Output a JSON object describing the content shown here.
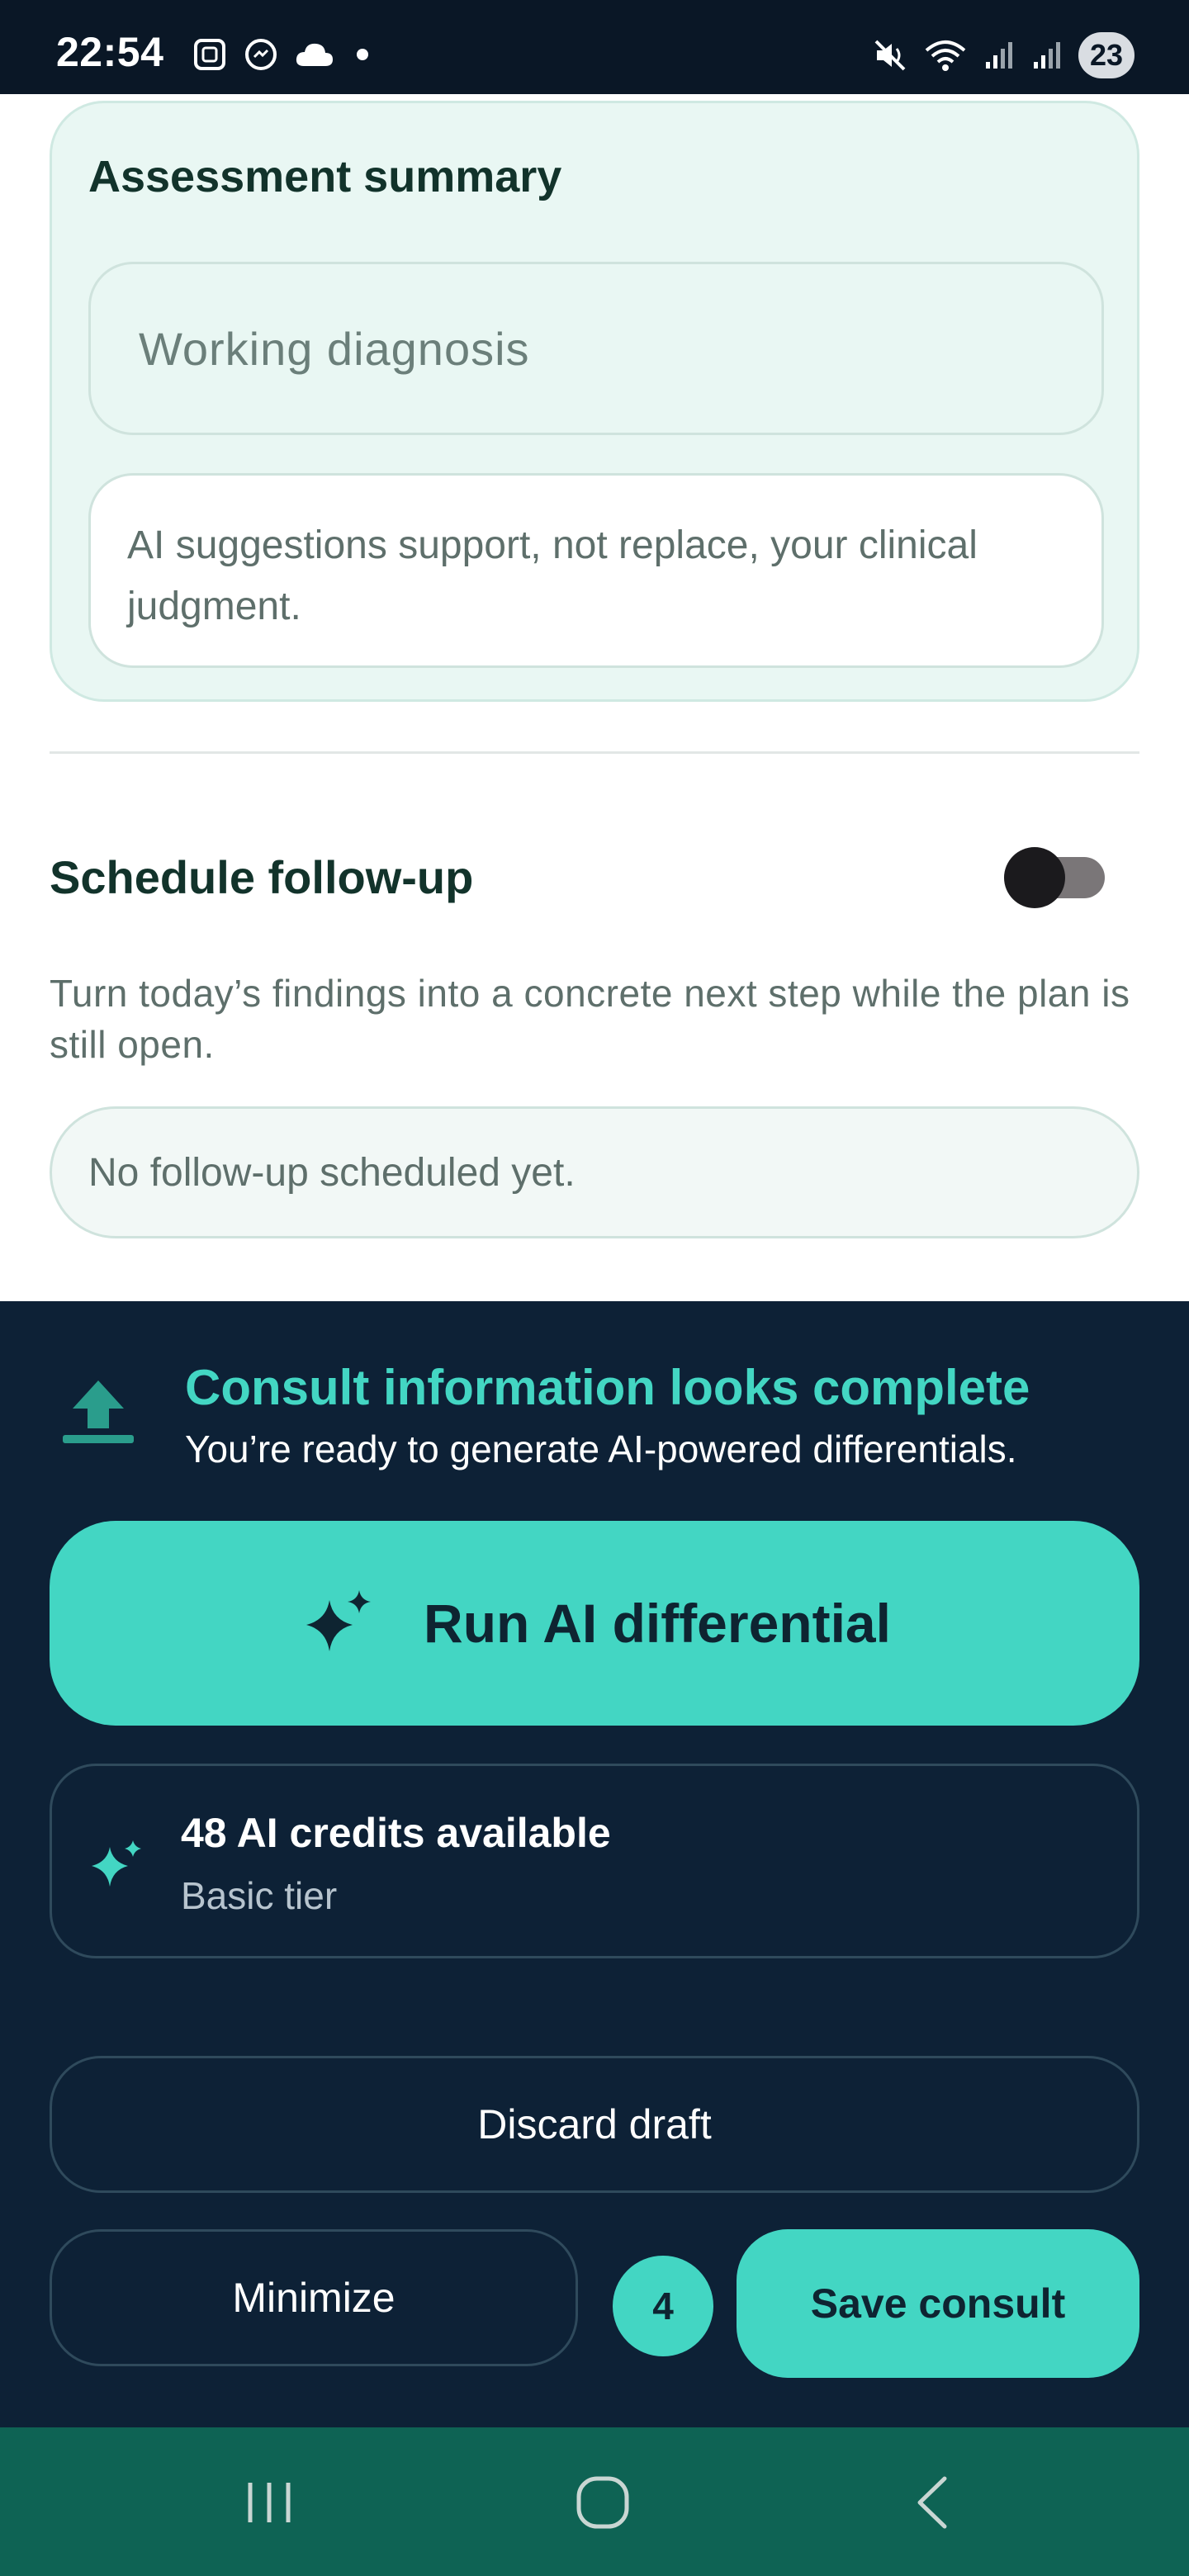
{
  "status_bar": {
    "time": "22:54",
    "left_icons": [
      "screenshot-icon",
      "messenger-icon",
      "cloud-icon",
      "dot-icon"
    ],
    "right_icons": [
      "mute-icon",
      "wifi-icon",
      "signal-icon",
      "signal-icon"
    ],
    "battery": "23"
  },
  "assessment": {
    "title": "Assessment summary",
    "working_diagnosis_placeholder": "Working diagnosis",
    "ai_note": "AI suggestions support, not replace, your clinical judgment."
  },
  "followup": {
    "title": "Schedule follow-up",
    "toggle_on": false,
    "description": "Turn today’s findings into a concrete next step while the plan is still open.",
    "empty_state": "No follow-up scheduled yet."
  },
  "readiness": {
    "icon": "upload-icon",
    "title": "Consult information looks complete",
    "subtitle": "You’re ready to generate AI-powered differentials."
  },
  "run_ai": {
    "icon": "sparkle-icon",
    "label": "Run AI differential"
  },
  "credits": {
    "icon": "sparkle-icon",
    "title": "48 AI credits available",
    "tier": "Basic tier"
  },
  "actions": {
    "discard": "Discard draft",
    "minimize": "Minimize",
    "count": "4",
    "save": "Save consult"
  },
  "colors": {
    "accent": "#43d6c3",
    "panel": "#0d2136",
    "nav": "#0e6354",
    "card_bg": "#e9f7f3"
  },
  "nav_bar": {
    "icons": [
      "recent-apps-icon",
      "home-icon",
      "back-icon"
    ]
  }
}
